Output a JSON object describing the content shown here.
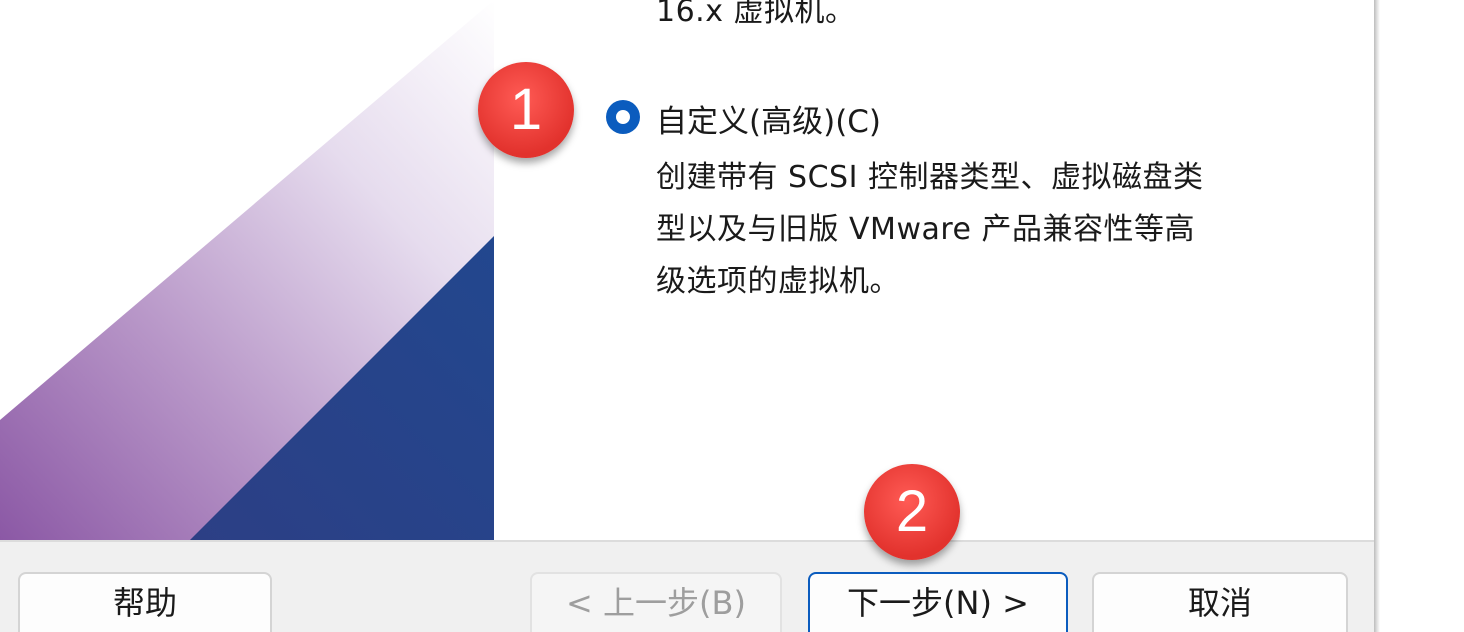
{
  "content": {
    "previous_option_desc_tail": "16.x 虚拟机。",
    "custom_option": {
      "label": "自定义(高级)(C)",
      "selected": true,
      "description_lines": [
        "创建带有 SCSI 控制器类型、虚拟磁盘类",
        "型以及与旧版 VMware 产品兼容性等高",
        "级选项的虚拟机。"
      ]
    }
  },
  "annotations": {
    "step1": "1",
    "step2": "2"
  },
  "footer": {
    "help_label": "帮助",
    "back_label": "< 上一步(B)",
    "next_label": "下一步(N) >",
    "cancel_label": "取消",
    "back_enabled": false
  },
  "colors": {
    "accent_blue": "#0b5cbe",
    "badge_red": "#e2322d",
    "banner_navy": "#26458c",
    "banner_purple": "#8d5aa6"
  },
  "icons": {
    "radio": "radio-selected-icon"
  }
}
